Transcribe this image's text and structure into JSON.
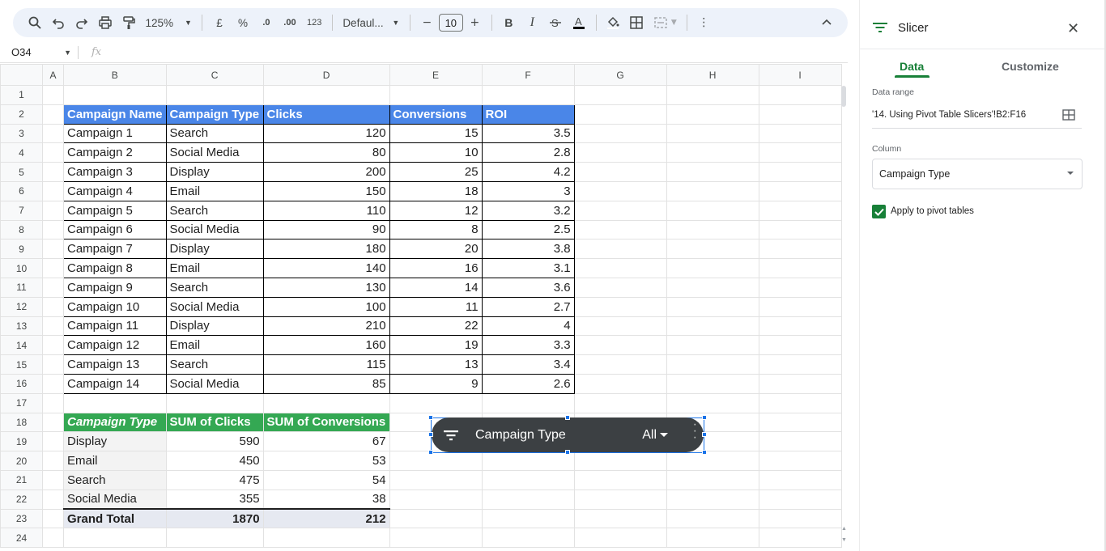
{
  "toolbar": {
    "zoom": "125%",
    "currency": "£",
    "percent": "%",
    "dec_decrease": ".0",
    "dec_increase": ".00",
    "number_format": "123",
    "font_name": "Defaul...",
    "font_size": "10"
  },
  "formula_bar": {
    "name_box": "O34",
    "fx_label": "fx"
  },
  "columns": [
    "A",
    "B",
    "C",
    "D",
    "E",
    "F",
    "G",
    "H",
    "I"
  ],
  "rows": [
    "1",
    "2",
    "3",
    "4",
    "5",
    "6",
    "7",
    "8",
    "9",
    "10",
    "11",
    "12",
    "13",
    "14",
    "15",
    "16",
    "17",
    "18",
    "19",
    "20",
    "21",
    "22",
    "23",
    "24"
  ],
  "data_table": {
    "headers": [
      "Campaign Name",
      "Campaign Type",
      "Clicks",
      "Conversions",
      "ROI"
    ],
    "rows": [
      [
        "Campaign 1",
        "Search",
        "120",
        "15",
        "3.5"
      ],
      [
        "Campaign 2",
        "Social Media",
        "80",
        "10",
        "2.8"
      ],
      [
        "Campaign 3",
        "Display",
        "200",
        "25",
        "4.2"
      ],
      [
        "Campaign 4",
        "Email",
        "150",
        "18",
        "3"
      ],
      [
        "Campaign 5",
        "Search",
        "110",
        "12",
        "3.2"
      ],
      [
        "Campaign 6",
        "Social Media",
        "90",
        "8",
        "2.5"
      ],
      [
        "Campaign 7",
        "Display",
        "180",
        "20",
        "3.8"
      ],
      [
        "Campaign 8",
        "Email",
        "140",
        "16",
        "3.1"
      ],
      [
        "Campaign 9",
        "Search",
        "130",
        "14",
        "3.6"
      ],
      [
        "Campaign 10",
        "Social Media",
        "100",
        "11",
        "2.7"
      ],
      [
        "Campaign 11",
        "Display",
        "210",
        "22",
        "4"
      ],
      [
        "Campaign 12",
        "Email",
        "160",
        "19",
        "3.3"
      ],
      [
        "Campaign 13",
        "Search",
        "115",
        "13",
        "3.4"
      ],
      [
        "Campaign 14",
        "Social Media",
        "85",
        "9",
        "2.6"
      ]
    ]
  },
  "pivot_table": {
    "headers": [
      "Campaign Type",
      "SUM of Clicks",
      "SUM of Conversions"
    ],
    "rows": [
      [
        "Display",
        "590",
        "67"
      ],
      [
        "Email",
        "450",
        "53"
      ],
      [
        "Search",
        "475",
        "54"
      ],
      [
        "Social Media",
        "355",
        "38"
      ]
    ],
    "total": [
      "Grand Total",
      "1870",
      "212"
    ]
  },
  "slicer_widget": {
    "title": "Campaign Type",
    "value": "All"
  },
  "panel": {
    "title": "Slicer",
    "tabs": [
      "Data",
      "Customize"
    ],
    "data_range_label": "Data range",
    "data_range_value": "'14. Using Pivot Table Slicers'!B2:F16",
    "column_label": "Column",
    "column_value": "Campaign Type",
    "apply_label": "Apply to pivot tables",
    "apply_checked": true
  },
  "colors": {
    "header_blue": "#4a86e8",
    "pivot_green": "#34a853",
    "accent_green": "#188038",
    "slicer_bg": "#3c4043",
    "selection_blue": "#1a73e8"
  }
}
